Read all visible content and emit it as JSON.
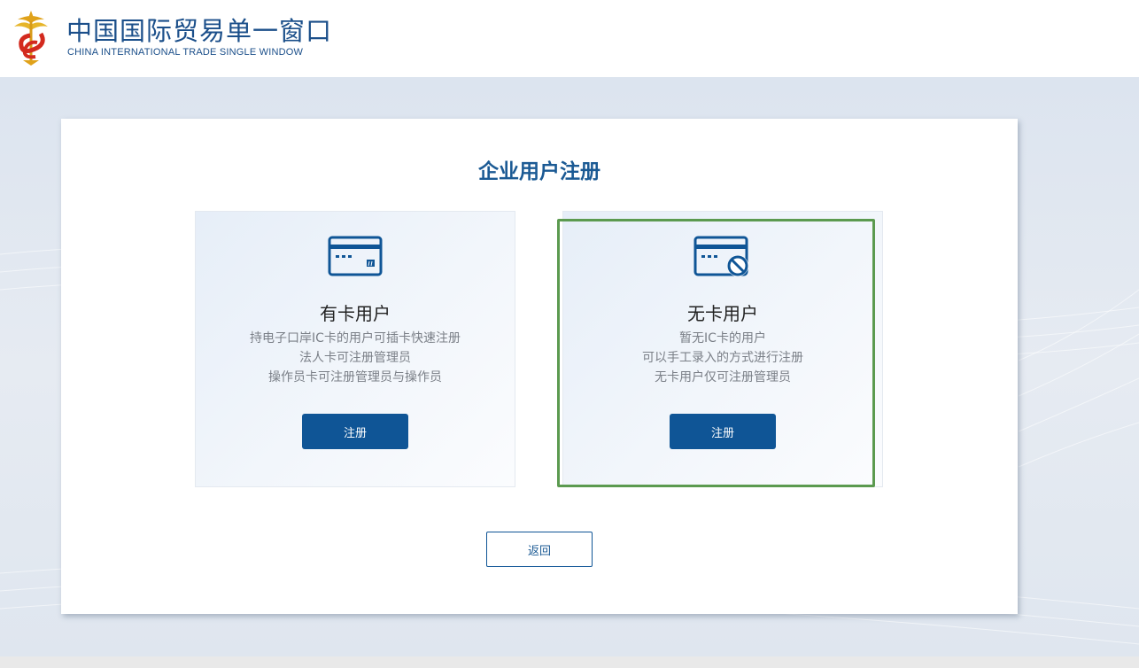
{
  "header": {
    "logo_title_cn": "中国国际贸易单一窗口",
    "logo_title_en": "CHINA INTERNATIONAL TRADE SINGLE WINDOW"
  },
  "page": {
    "title": "企业用户注册",
    "cards": [
      {
        "title": "有卡用户",
        "icon": "ic-card-icon",
        "desc": [
          "持电子口岸IC卡的用户可插卡快速注册",
          "法人卡可注册管理员",
          "操作员卡可注册管理员与操作员"
        ],
        "button_label": "注册"
      },
      {
        "title": "无卡用户",
        "icon": "no-card-icon",
        "desc": [
          "暂无IC卡的用户",
          "可以手工录入的方式进行注册",
          "无卡用户仅可注册管理员"
        ],
        "button_label": "注册"
      }
    ],
    "back_label": "返回"
  },
  "colors": {
    "brand_blue": "#0f5596",
    "title_blue": "#1b5a94",
    "highlight_green": "#5b9a4f"
  }
}
